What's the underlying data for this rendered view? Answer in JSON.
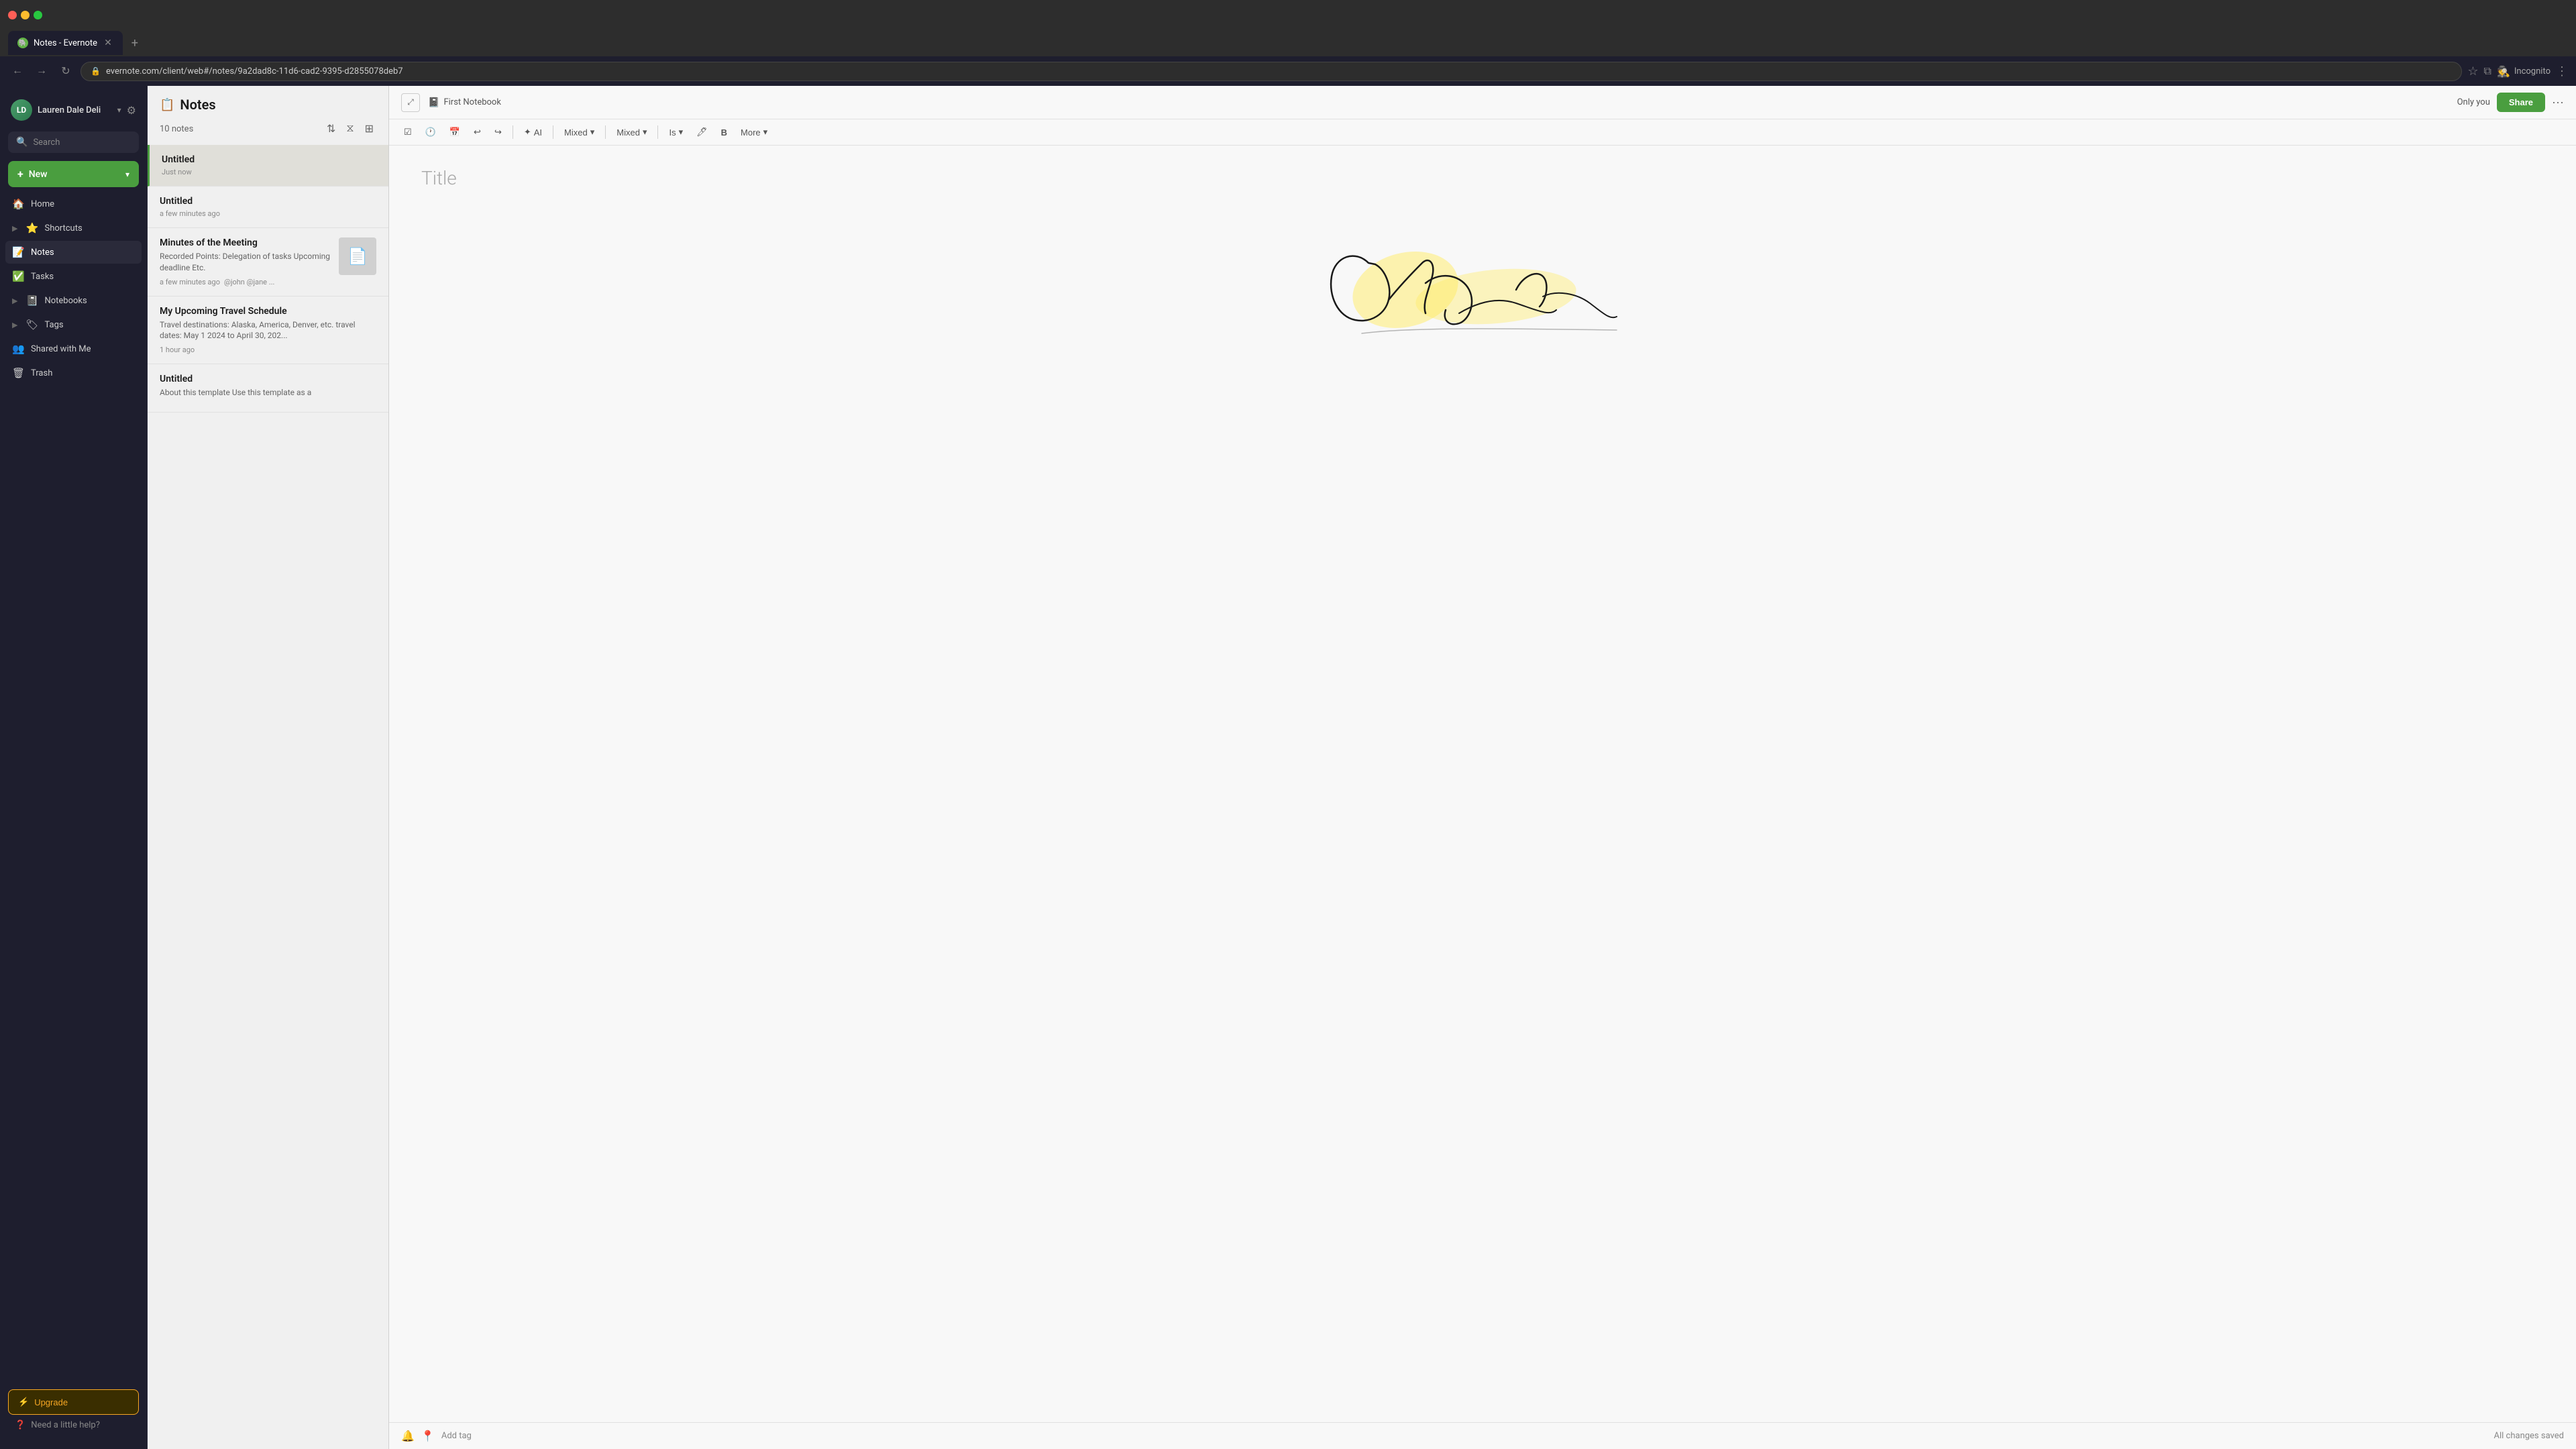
{
  "browser": {
    "url": "evernote.com/client/web#/notes/9a2dad8c-11d6-cad2-9395-d2855078deb7",
    "tab_title": "Notes - Evernote",
    "incognito_label": "Incognito",
    "new_tab_label": "+"
  },
  "sidebar": {
    "user_name": "Lauren Dale Deli",
    "user_initials": "LD",
    "search_placeholder": "Search",
    "new_label": "New",
    "nav_items": [
      {
        "id": "home",
        "icon": "🏠",
        "label": "Home"
      },
      {
        "id": "shortcuts",
        "icon": "⭐",
        "label": "Shortcuts",
        "expandable": true
      },
      {
        "id": "notes",
        "icon": "📝",
        "label": "Notes",
        "active": true
      },
      {
        "id": "tasks",
        "icon": "✅",
        "label": "Tasks"
      },
      {
        "id": "notebooks",
        "icon": "📓",
        "label": "Notebooks",
        "expandable": true
      },
      {
        "id": "tags",
        "icon": "🏷",
        "label": "Tags",
        "expandable": true
      },
      {
        "id": "shared",
        "icon": "👥",
        "label": "Shared with Me"
      },
      {
        "id": "trash",
        "icon": "🗑",
        "label": "Trash"
      }
    ],
    "upgrade_label": "Upgrade",
    "upgrade_icon": "⚡",
    "help_label": "Need a little help?",
    "help_icon": "❓"
  },
  "notes_panel": {
    "title": "Notes",
    "title_icon": "📋",
    "count": "10 notes",
    "notes": [
      {
        "id": "1",
        "title": "Untitled",
        "preview": "",
        "time": "Just now",
        "has_thumb": false,
        "active": true
      },
      {
        "id": "2",
        "title": "Untitled",
        "preview": "",
        "time": "a few minutes ago",
        "has_thumb": false,
        "active": false
      },
      {
        "id": "3",
        "title": "Minutes of the Meeting",
        "preview": "Recorded Points: Delegation of tasks Upcoming deadline Etc.",
        "time": "a few minutes ago",
        "meta": "@john @jane ...",
        "has_thumb": true,
        "active": false
      },
      {
        "id": "4",
        "title": "My Upcoming Travel Schedule",
        "preview": "Travel destinations: Alaska, America, Denver, etc. travel dates: May 1 2024 to April 30, 202...",
        "time": "1 hour ago",
        "has_thumb": false,
        "active": false
      },
      {
        "id": "5",
        "title": "Untitled",
        "preview": "About this template Use this template as a",
        "time": "",
        "has_thumb": false,
        "active": false
      }
    ]
  },
  "editor": {
    "notebook_name": "First Notebook",
    "only_you_label": "Only you",
    "share_label": "Share",
    "title_placeholder": "Title",
    "toolbar": {
      "undo_icon": "↩",
      "redo_icon": "↪",
      "calendar_icon": "📅",
      "ai_label": "AI",
      "font_style": "Mixed",
      "font_size": "Mixed",
      "heading": "Is",
      "bold_label": "B",
      "more_label": "More"
    },
    "footer": {
      "add_tag_label": "Add tag",
      "saved_label": "All changes saved"
    }
  }
}
